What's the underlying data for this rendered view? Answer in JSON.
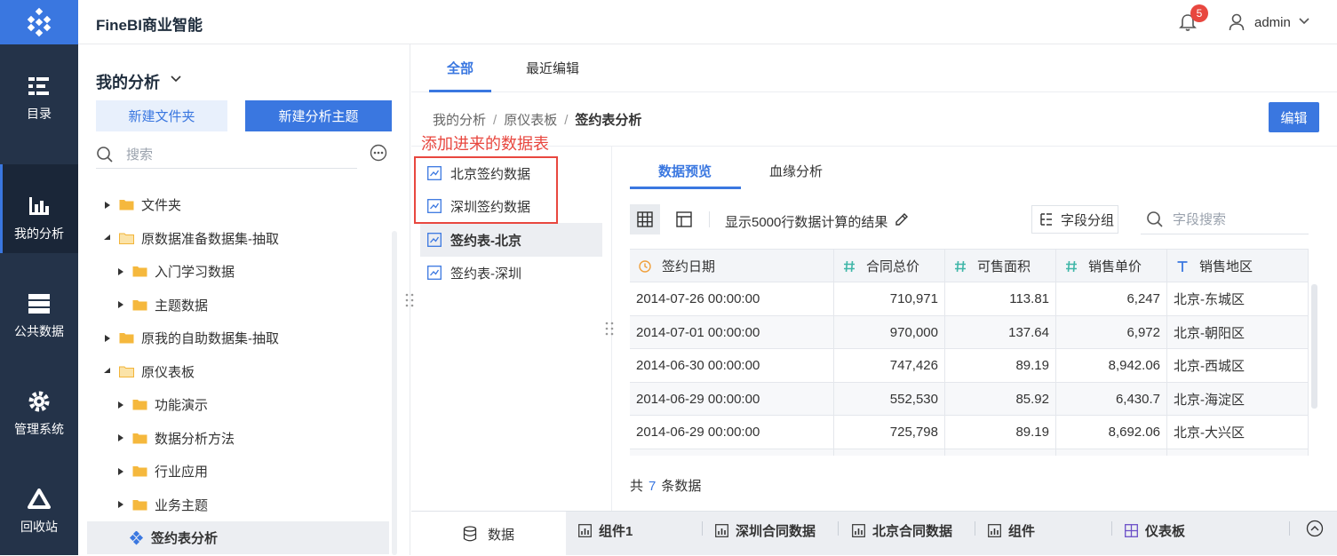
{
  "app": {
    "title": "FineBI商业智能"
  },
  "header": {
    "notification_count": "5",
    "user": "admin"
  },
  "nav": [
    {
      "label": "目录",
      "icon": "catalog-icon"
    },
    {
      "label": "我的分析",
      "icon": "analysis-icon",
      "active": true
    },
    {
      "label": "公共数据",
      "icon": "database-icon"
    },
    {
      "label": "管理系统",
      "icon": "gear-icon"
    },
    {
      "label": "回收站",
      "icon": "recycle-icon"
    }
  ],
  "directory": {
    "title": "我的分析",
    "new_folder": "新建文件夹",
    "new_subject": "新建分析主题",
    "search_placeholder": "搜索",
    "tree": [
      {
        "label": "文件夹",
        "level": 0,
        "expanded": false
      },
      {
        "label": "原数据准备数据集-抽取",
        "level": 0,
        "expanded": true
      },
      {
        "label": "入门学习数据",
        "level": 1,
        "expanded": false
      },
      {
        "label": "主题数据",
        "level": 1,
        "expanded": false
      },
      {
        "label": "原我的自助数据集-抽取",
        "level": 0,
        "expanded": false
      },
      {
        "label": "原仪表板",
        "level": 0,
        "expanded": true
      },
      {
        "label": "功能演示",
        "level": 1,
        "expanded": false
      },
      {
        "label": "数据分析方法",
        "level": 1,
        "expanded": false
      },
      {
        "label": "行业应用",
        "level": 1,
        "expanded": false
      },
      {
        "label": "业务主题",
        "level": 1,
        "expanded": false
      },
      {
        "label": "签约表分析",
        "level": 1,
        "selected": true
      }
    ]
  },
  "tabs": {
    "all": "全部",
    "recent": "最近编辑"
  },
  "breadcrumb": {
    "items": [
      "我的分析",
      "原仪表板",
      "签约表分析"
    ],
    "sep": "/"
  },
  "edit_button": "编辑",
  "annotation": "添加进来的数据表",
  "tables": [
    {
      "label": "北京签约数据"
    },
    {
      "label": "深圳签约数据"
    },
    {
      "label": "签约表-北京",
      "selected": true
    },
    {
      "label": "签约表-深圳"
    }
  ],
  "subtabs": {
    "preview": "数据预览",
    "lineage": "血缘分析"
  },
  "toolbar": {
    "info": "显示5000行数据计算的结果",
    "field_group": "字段分组",
    "field_search_placeholder": "字段搜索"
  },
  "grid": {
    "columns": [
      {
        "label": "签约日期",
        "type": "date"
      },
      {
        "label": "合同总价",
        "type": "number"
      },
      {
        "label": "可售面积",
        "type": "number"
      },
      {
        "label": "销售单价",
        "type": "number"
      },
      {
        "label": "销售地区",
        "type": "text"
      }
    ],
    "rows": [
      [
        "2014-07-26 00:00:00",
        "710,971",
        "113.81",
        "6,247",
        "北京-东城区"
      ],
      [
        "2014-07-01 00:00:00",
        "970,000",
        "137.64",
        "6,972",
        "北京-朝阳区"
      ],
      [
        "2014-06-30 00:00:00",
        "747,426",
        "89.19",
        "8,942.06",
        "北京-西城区"
      ],
      [
        "2014-06-29 00:00:00",
        "552,530",
        "85.92",
        "6,430.7",
        "北京-海淀区"
      ],
      [
        "2014-06-29 00:00:00",
        "725,798",
        "89.19",
        "8,692.06",
        "北京-大兴区"
      ]
    ]
  },
  "total": {
    "prefix": "共",
    "count": "7",
    "suffix": "条数据"
  },
  "bottom": {
    "data": "数据",
    "tabs": [
      "组件1",
      "深圳合同数据",
      "北京合同数据",
      "组件",
      "仪表板"
    ]
  },
  "colors": {
    "accent": "#3a77e0",
    "nav_bg": "#243349",
    "alert": "#e8473f"
  }
}
